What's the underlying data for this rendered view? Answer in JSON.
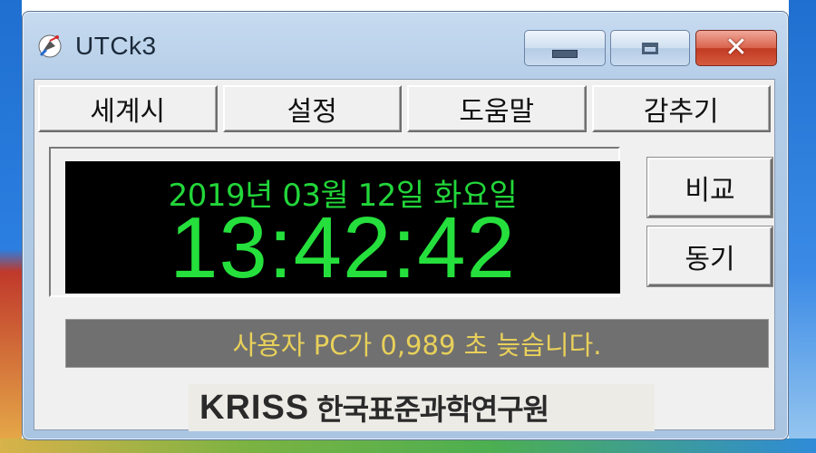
{
  "window": {
    "title": "UTCk3",
    "icon": "satellite-dish-icon"
  },
  "menu": {
    "items": [
      {
        "label": "세계시"
      },
      {
        "label": "설정"
      },
      {
        "label": "도움말"
      },
      {
        "label": "감추기"
      }
    ]
  },
  "clock": {
    "date": "2019년 03월 12일 화요일",
    "time": "13:42:42",
    "color": "#25e03c"
  },
  "side_buttons": {
    "compare": "비교",
    "sync": "동기"
  },
  "status": {
    "message": "사용자 PC가 0,989 초 늦습니다.",
    "text_color": "#e8d05a"
  },
  "logo": {
    "brand": "KRISS",
    "org": "한국표준과학연구원"
  },
  "controls": {
    "minimize": "minimize-icon",
    "maximize": "maximize-icon",
    "close": "close-icon"
  }
}
